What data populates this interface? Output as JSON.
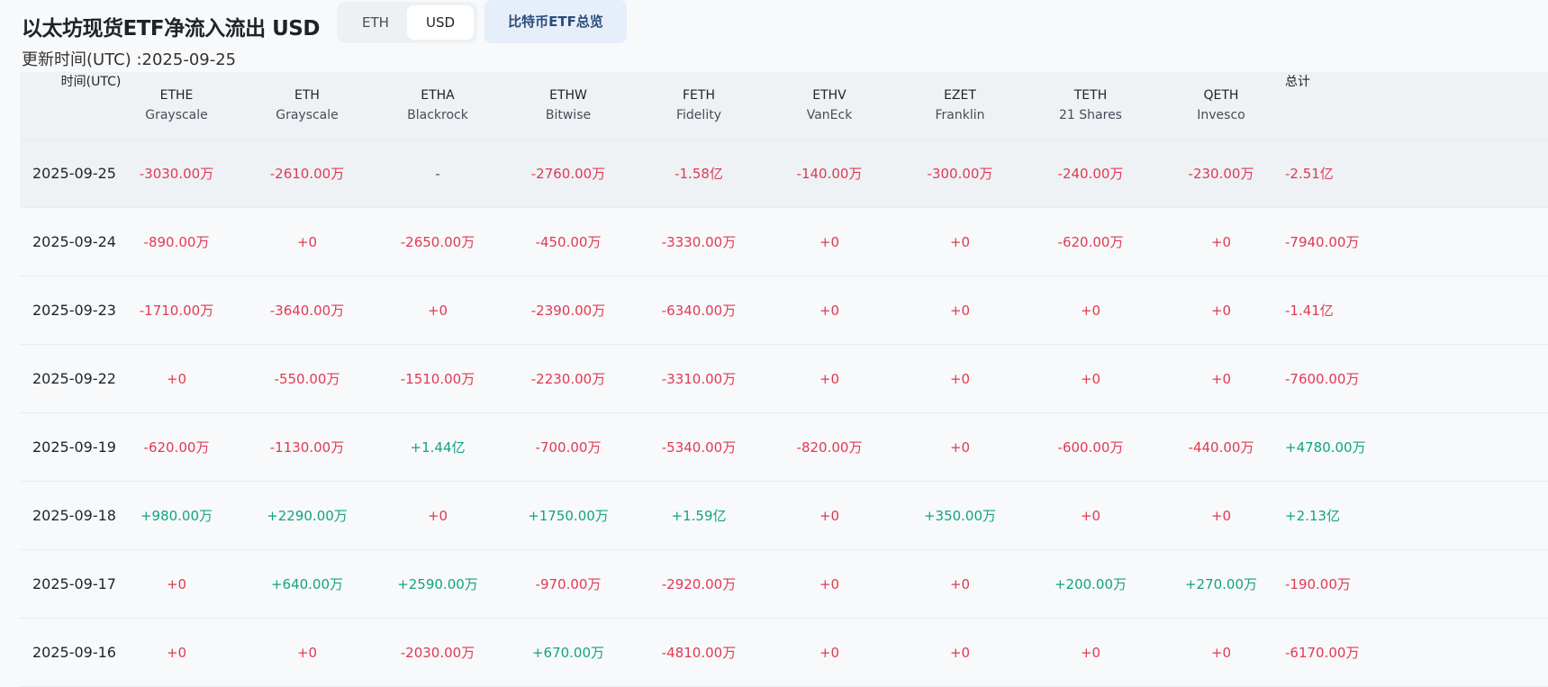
{
  "header": {
    "title": "以太坊现货ETF净流入流出 USD",
    "unit_options": [
      "ETH",
      "USD"
    ],
    "selected_unit": "USD",
    "btc_overview_label": "比特币ETF总览",
    "updated_text": "更新时间(UTC) :2025-09-25"
  },
  "table": {
    "columns": [
      {
        "code": "时间(UTC)",
        "issuer": ""
      },
      {
        "code": "ETHE",
        "issuer": "Grayscale"
      },
      {
        "code": "ETH",
        "issuer": "Grayscale"
      },
      {
        "code": "ETHA",
        "issuer": "Blackrock"
      },
      {
        "code": "ETHW",
        "issuer": "Bitwise"
      },
      {
        "code": "FETH",
        "issuer": "Fidelity"
      },
      {
        "code": "ETHV",
        "issuer": "VanEck"
      },
      {
        "code": "EZET",
        "issuer": "Franklin"
      },
      {
        "code": "TETH",
        "issuer": "21 Shares"
      },
      {
        "code": "QETH",
        "issuer": "Invesco"
      },
      {
        "code": "总计",
        "issuer": ""
      }
    ],
    "rows": [
      {
        "date": "2025-09-25",
        "values": [
          "-3030.00万",
          "-2610.00万",
          "-",
          "-2760.00万",
          "-1.58亿",
          "-140.00万",
          "-300.00万",
          "-240.00万",
          "-230.00万",
          "-2.51亿"
        ]
      },
      {
        "date": "2025-09-24",
        "values": [
          "-890.00万",
          "+0",
          "-2650.00万",
          "-450.00万",
          "-3330.00万",
          "+0",
          "+0",
          "-620.00万",
          "+0",
          "-7940.00万"
        ]
      },
      {
        "date": "2025-09-23",
        "values": [
          "-1710.00万",
          "-3640.00万",
          "+0",
          "-2390.00万",
          "-6340.00万",
          "+0",
          "+0",
          "+0",
          "+0",
          "-1.41亿"
        ]
      },
      {
        "date": "2025-09-22",
        "values": [
          "+0",
          "-550.00万",
          "-1510.00万",
          "-2230.00万",
          "-3310.00万",
          "+0",
          "+0",
          "+0",
          "+0",
          "-7600.00万"
        ]
      },
      {
        "date": "2025-09-19",
        "values": [
          "-620.00万",
          "-1130.00万",
          "+1.44亿",
          "-700.00万",
          "-5340.00万",
          "-820.00万",
          "+0",
          "-600.00万",
          "-440.00万",
          "+4780.00万"
        ]
      },
      {
        "date": "2025-09-18",
        "values": [
          "+980.00万",
          "+2290.00万",
          "+0",
          "+1750.00万",
          "+1.59亿",
          "+0",
          "+350.00万",
          "+0",
          "+0",
          "+2.13亿"
        ]
      },
      {
        "date": "2025-09-17",
        "values": [
          "+0",
          "+640.00万",
          "+2590.00万",
          "-970.00万",
          "-2920.00万",
          "+0",
          "+0",
          "+200.00万",
          "+270.00万",
          "-190.00万"
        ]
      },
      {
        "date": "2025-09-16",
        "values": [
          "+0",
          "+0",
          "-2030.00万",
          "+670.00万",
          "-4810.00万",
          "+0",
          "+0",
          "+0",
          "+0",
          "-6170.00万"
        ]
      }
    ]
  },
  "colors": {
    "negative": "#e03a52",
    "positive": "#12a383",
    "zero": "#e03a52",
    "neutral": "#474d57"
  }
}
